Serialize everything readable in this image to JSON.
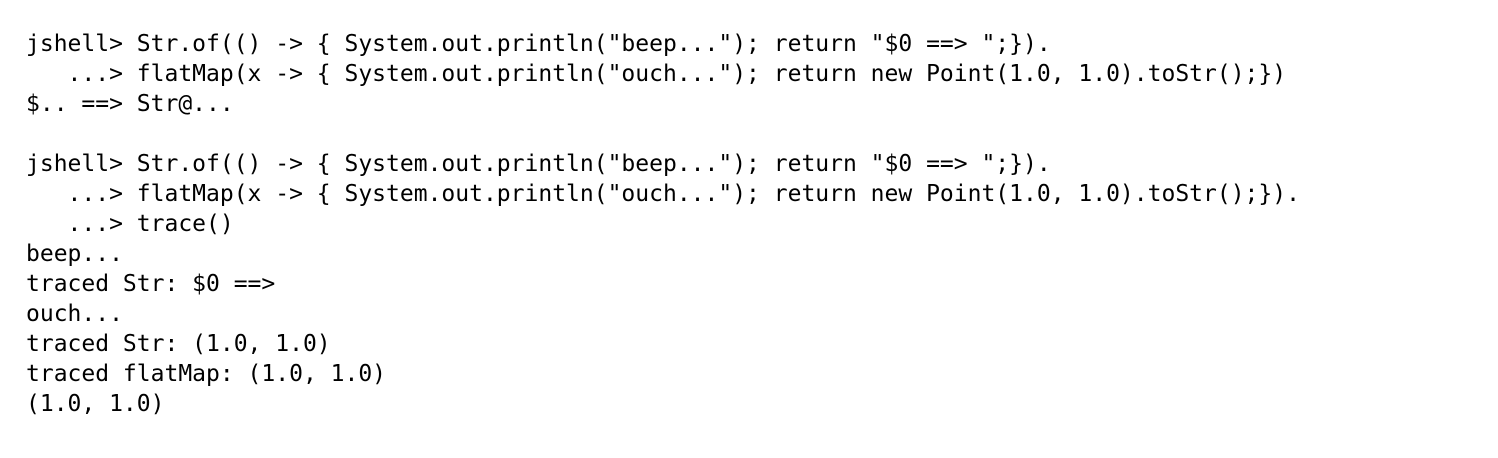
{
  "session": {
    "block1": {
      "prompt": "jshell> Str.of(() -> { System.out.println(\"beep...\"); return \"$0 ==> \";}).",
      "cont1": "   ...> flatMap(x -> { System.out.println(\"ouch...\"); return new Point(1.0, 1.0).toStr();})",
      "result": "$.. ==> Str@..."
    },
    "block2": {
      "prompt": "jshell> Str.of(() -> { System.out.println(\"beep...\"); return \"$0 ==> \";}).",
      "cont1": "   ...> flatMap(x -> { System.out.println(\"ouch...\"); return new Point(1.0, 1.0).toStr();}).",
      "cont2": "   ...> trace()",
      "output": [
        "beep...",
        "traced Str: $0 ==>",
        "ouch...",
        "traced Str: (1.0, 1.0)",
        "traced flatMap: (1.0, 1.0)",
        "(1.0, 1.0)"
      ]
    }
  }
}
